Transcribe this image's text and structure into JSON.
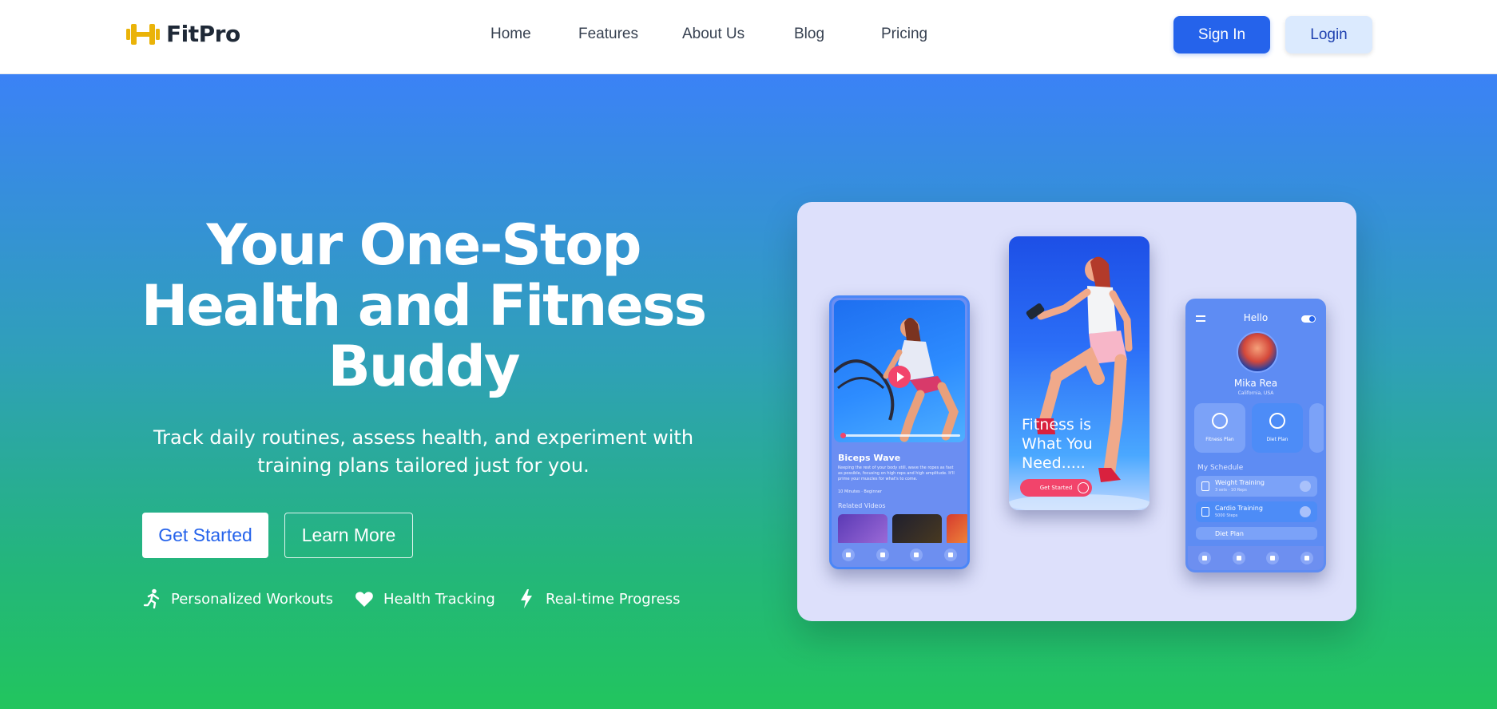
{
  "brand": {
    "name": "FitPro",
    "icon": "dumbbell-icon",
    "accent": "#eab308"
  },
  "nav": {
    "links": [
      "Home",
      "Features",
      "About Us",
      "Blog",
      "Pricing"
    ],
    "signin_label": "Sign In",
    "login_label": "Login"
  },
  "hero": {
    "title": "Your One-Stop Health and Fitness Buddy",
    "subtitle": "Track daily routines, assess health, and experiment with training plans tailored just for you.",
    "get_started_label": "Get Started",
    "learn_more_label": "Learn More",
    "features": [
      {
        "icon": "running-icon",
        "label": "Personalized Workouts"
      },
      {
        "icon": "heart-icon",
        "label": "Health Tracking"
      },
      {
        "icon": "lightning-icon",
        "label": "Real-time Progress"
      }
    ]
  },
  "mockups": {
    "video_phone": {
      "title": "Biceps Wave",
      "description": "Keeping the rest of your body still, wave the ropes as fast as possible, focusing on high reps and high amplitude. It'll prime your muscles for what's to come.",
      "meta": "10 Minutes · Beginner",
      "related_label": "Related Videos"
    },
    "promo_phone": {
      "tagline": "Fitness is What You Need.....",
      "cta_label": "Get Started"
    },
    "profile_phone": {
      "greeting": "Hello",
      "name": "Mika Rea",
      "location": "California, USA",
      "cards": [
        "Fitness Plan",
        "Diet Plan"
      ],
      "schedule_label": "My Schedule",
      "schedule": [
        {
          "title": "Weight Training",
          "sub": "3 sets · 10 Reps"
        },
        {
          "title": "Cardio Training",
          "sub": "5000 Steps"
        },
        {
          "title": "Diet Plan",
          "sub": ""
        }
      ]
    }
  },
  "colors": {
    "primary": "#2563eb",
    "hero_top": "#3b82f6",
    "hero_bottom": "#22c55e",
    "accent_pink": "#f2446b"
  }
}
